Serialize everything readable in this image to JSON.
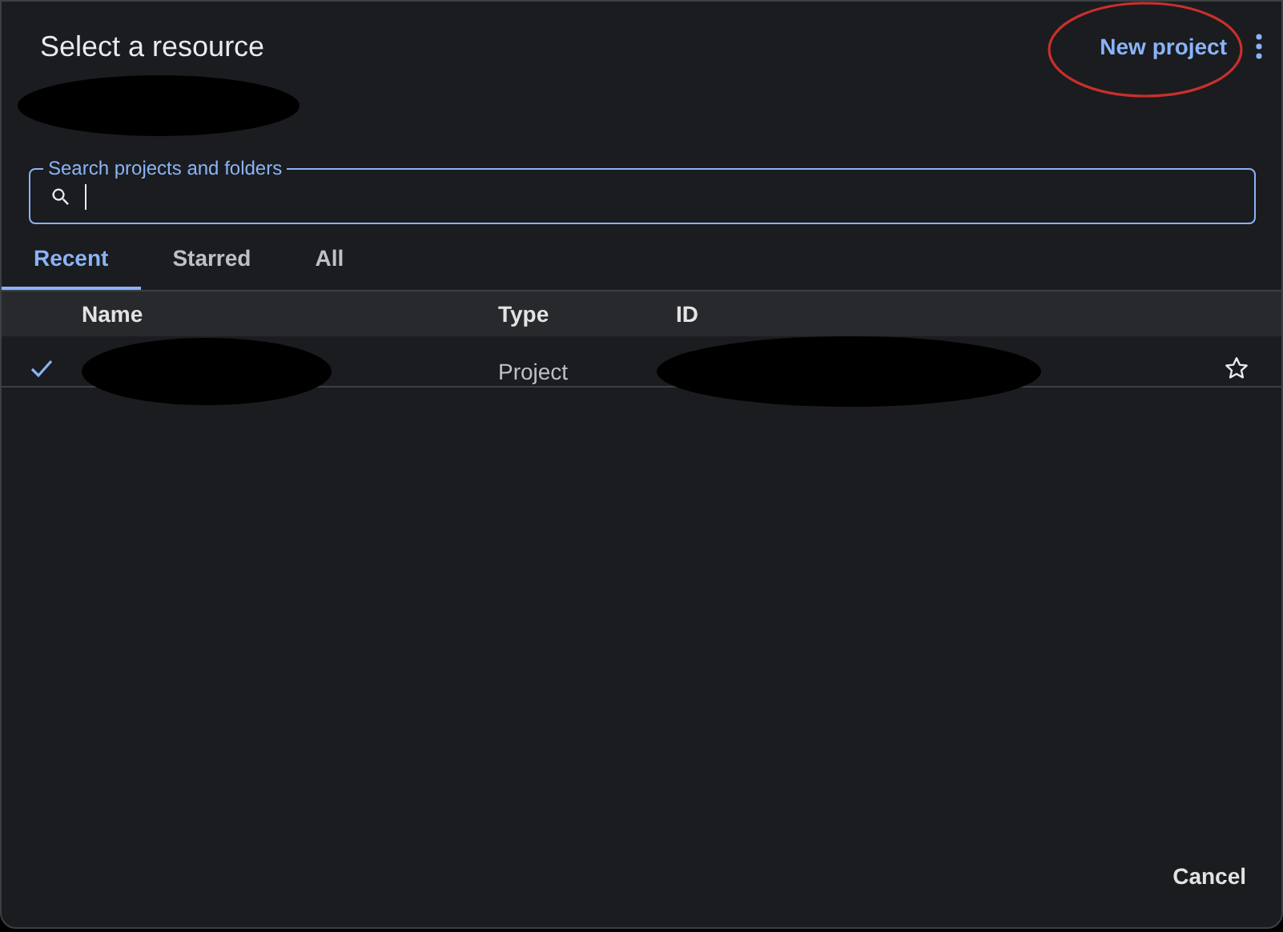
{
  "dialog": {
    "title": "Select a resource",
    "action": "New project"
  },
  "search": {
    "label": "Search projects and folders"
  },
  "tabs": [
    {
      "label": "Recent",
      "selected": true
    },
    {
      "label": "Starred",
      "selected": false
    },
    {
      "label": "All",
      "selected": false
    }
  ],
  "table": {
    "columns": [
      "Name",
      "Type",
      "ID"
    ],
    "rows": [
      {
        "selected": true,
        "type": "Project",
        "starred": false
      }
    ]
  },
  "footer": {
    "button": "Cancel"
  }
}
